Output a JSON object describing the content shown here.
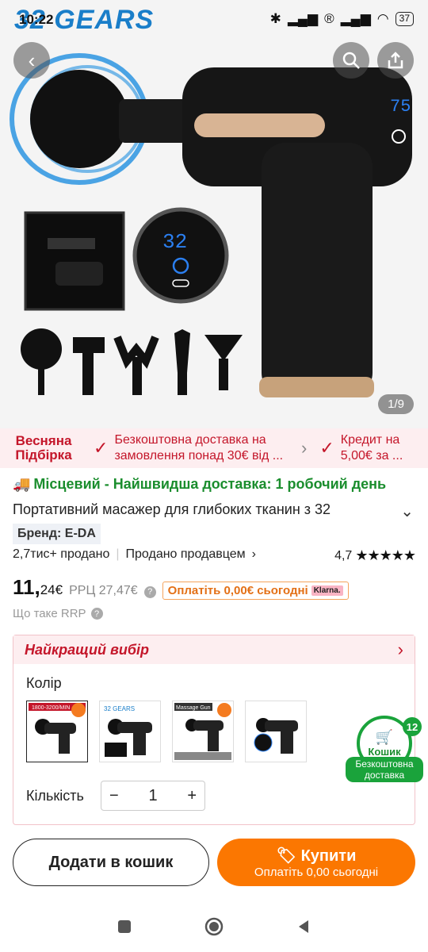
{
  "status": {
    "time": "10:22",
    "battery": "37"
  },
  "hero": {
    "brand": "32 GEARS",
    "counter": "1/9",
    "display_number": "32",
    "display_number_small": "75"
  },
  "promo": {
    "title": "Весняна Підбірка",
    "items": [
      "Безкоштовна доставка на замовлення понад 30€ від ...",
      "Кредит на 5,00€ за ..."
    ]
  },
  "local": "Місцевий - Найшвидша доставка: 1 робочий день",
  "product_title": "Портативний масажер для глибоких тканин з 32",
  "brand_tag": "Бренд: E-DA",
  "sold": "2,7тис+ продано",
  "seller": "Продано продавцем",
  "rating": "4,7",
  "price": {
    "main": "11,",
    "cents": "24€",
    "rrp": "РРЦ 27,47€",
    "klarna_text": "Оплатіть 0,00€ сьогодні",
    "klarna_logo": "Klarna."
  },
  "rrp_question": "Що таке RRP",
  "panel": {
    "title": "Найкращий вибір",
    "color_label": "Колір",
    "qty_label": "Кількість",
    "qty_value": "1",
    "thumb_labels": [
      "1800-3200/MIN",
      "32 GEARS",
      "Massage Gun"
    ]
  },
  "cart": {
    "count": "12",
    "label": "Кошик",
    "free": "Безкоштовна доставка"
  },
  "buttons": {
    "add": "Додати в кошик",
    "buy": "Купити",
    "buy_sub": "Оплатіть 0,00 сьогодні"
  }
}
